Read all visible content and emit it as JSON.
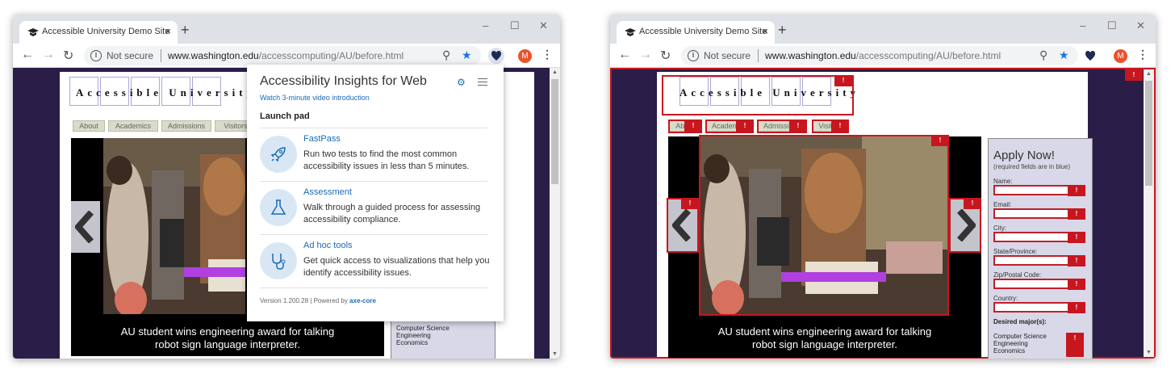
{
  "browser": {
    "tab_title": "Accessible University Demo Site",
    "new_tab": "+",
    "close_tab": "×",
    "not_secure": "Not secure",
    "url_host": "www.washington.edu",
    "url_path": "/accesscomputing/AU/before.html",
    "avatar_letter": "M",
    "minimize": "–",
    "maximize": "☐",
    "close": "✕"
  },
  "site": {
    "logo_text": "Accessible University",
    "nav_tabs": [
      "About",
      "Academics",
      "Admissions",
      "Visitors"
    ],
    "caption_line1": "AU student wins engineering award for talking",
    "caption_line2": "robot sign language interpreter.",
    "apply_title": "Apply Now!",
    "apply_sub": "(required fields are in blue)",
    "fields": [
      "Name:",
      "Email:",
      "City:",
      "State/Province:",
      "Zip/Postal Code:",
      "Country:"
    ],
    "desired_majors": "Desired major(s):",
    "majors": [
      "Computer Science",
      "Engineering",
      "Economics"
    ]
  },
  "insights": {
    "title": "Accessibility Insights for Web",
    "video_link": "Watch 3-minute video introduction",
    "launch_pad": "Launch pad",
    "items": [
      {
        "title": "FastPass",
        "desc": "Run two tests to find the most common accessibility issues in less than 5 minutes.",
        "icon": "rocket-icon"
      },
      {
        "title": "Assessment",
        "desc": "Walk through a guided process for assessing accessibility compliance.",
        "icon": "flask-icon"
      },
      {
        "title": "Ad hoc tools",
        "desc": "Get quick access to visualizations that help you identify accessibility issues.",
        "icon": "stethoscope-icon"
      }
    ],
    "footer_version": "Version 1.200.28 | Powered by ",
    "footer_axe": "axe-core"
  },
  "badge_text": "!",
  "colors": {
    "page_bg": "#2a1d47",
    "failure_red": "#c8161f",
    "link_blue": "#1a6ab8",
    "icon_circle": "#d9e7f5"
  }
}
